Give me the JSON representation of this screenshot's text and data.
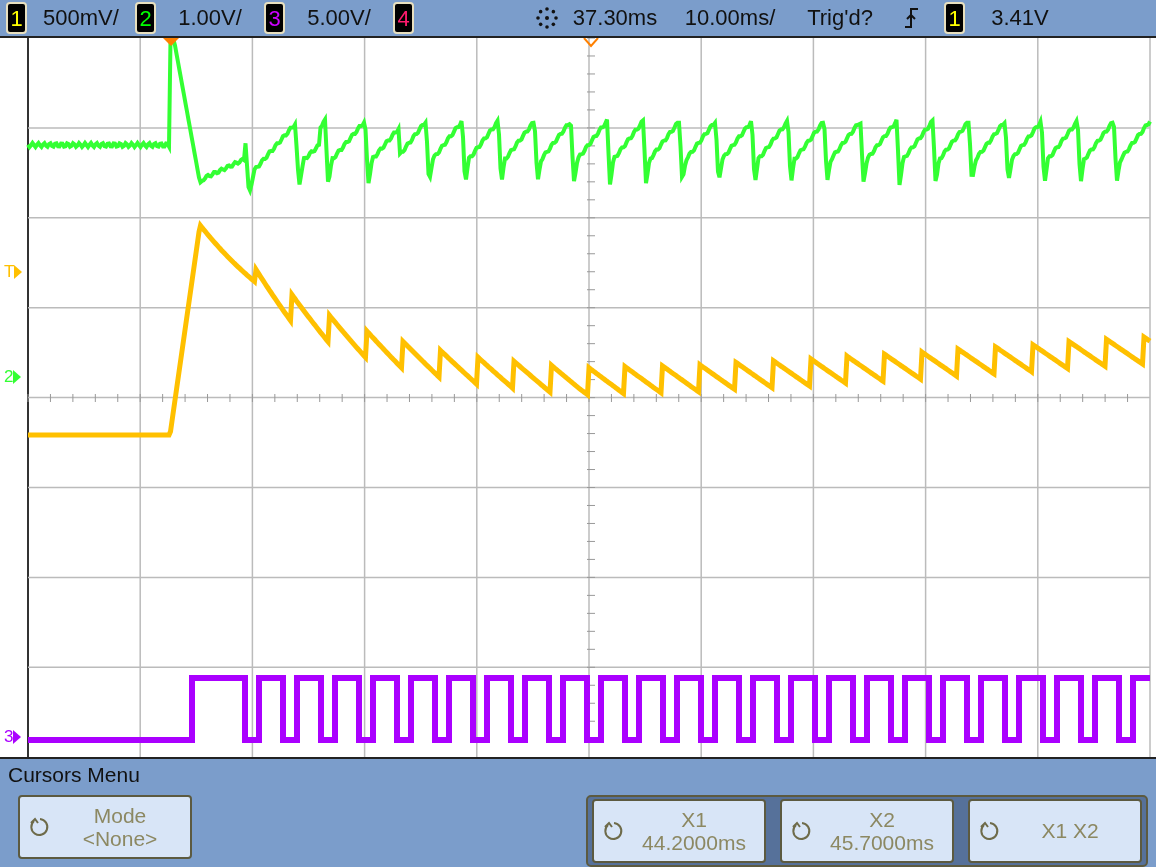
{
  "status_bar": {
    "channels": [
      {
        "number": "1",
        "scale": "500mV/",
        "color": "#ffff00"
      },
      {
        "number": "2",
        "scale": "1.00V/",
        "color": "#00ff00"
      },
      {
        "number": "3",
        "scale": "5.00V/",
        "color": "#cc00ff"
      },
      {
        "number": "4",
        "color": "#ff1a6e"
      }
    ],
    "delay": "37.30ms",
    "timebase": "10.00ms/",
    "trigger_status": "Trig'd?",
    "trigger_source": {
      "number": "1",
      "color": "#ffff00"
    },
    "trigger_level": "3.41V"
  },
  "markers": [
    {
      "label": "T",
      "color": "#ffc000"
    },
    {
      "label": "2",
      "color": "#33ff33"
    },
    {
      "label": "3",
      "color": "#aa00ff"
    }
  ],
  "menu": {
    "title": "Cursors Menu",
    "mode_key": {
      "label": "Mode",
      "value": "<None>"
    },
    "cursor_keys": [
      {
        "label": "X1",
        "value": "44.2000ms"
      },
      {
        "label": "X2",
        "value": "45.7000ms"
      },
      {
        "label": "X1 X2"
      }
    ]
  }
}
